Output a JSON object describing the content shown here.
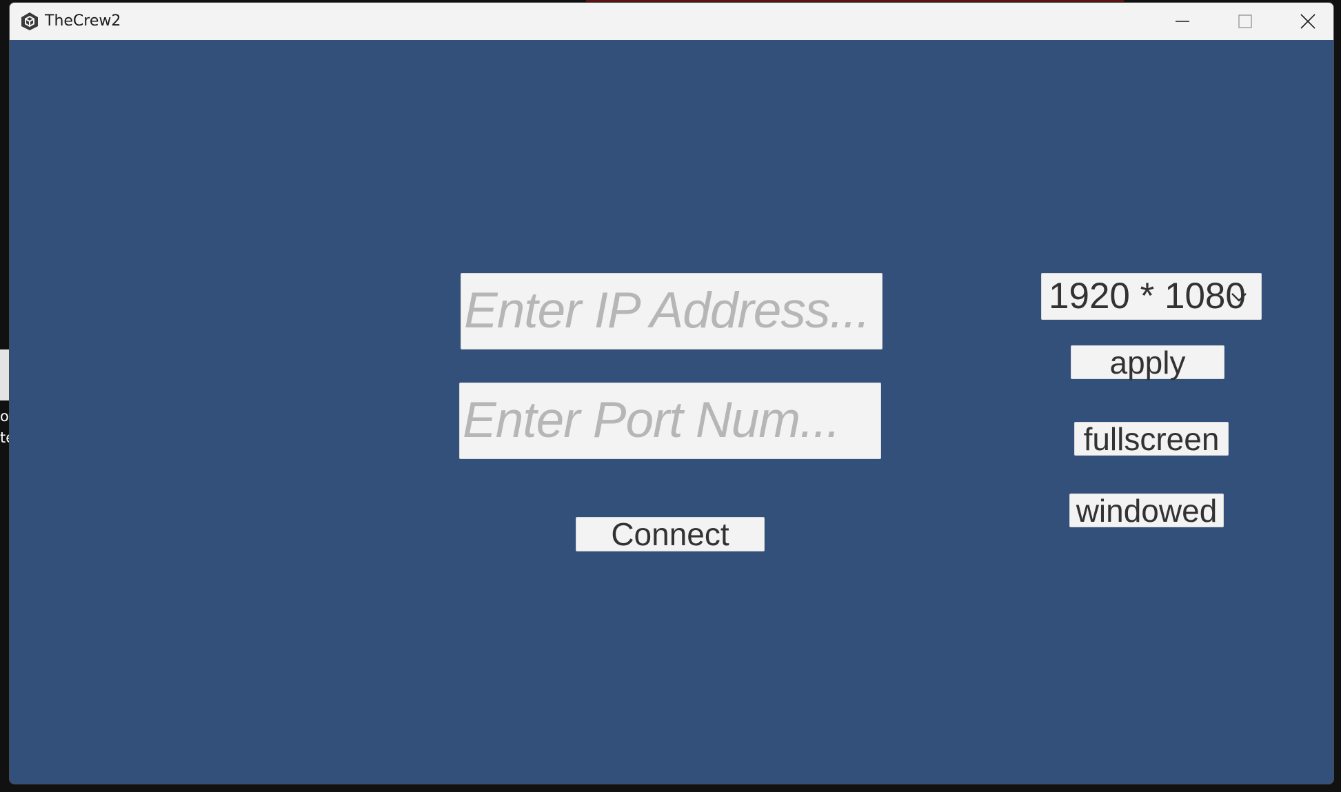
{
  "window": {
    "title": "TheCrew2",
    "app_icon": "unity-cube-icon",
    "controls": [
      "minimize-icon",
      "maximize-icon",
      "close-icon"
    ]
  },
  "connection": {
    "ip_placeholder": "Enter IP Address...",
    "port_placeholder": "Enter Port Num...",
    "connect_label": "Connect"
  },
  "display": {
    "resolution_selected": "1920 * 1080",
    "apply_label": "apply",
    "fullscreen_label": "fullscreen",
    "windowed_label": "windowed"
  },
  "background_desktop": {
    "line1": "o",
    "line2": "te"
  },
  "colors": {
    "client_background": "#33507b",
    "titlebar": "#f3f3f3",
    "control_background": "#f3f3f3",
    "placeholder_text": "#b6b6b6",
    "button_text": "#323232"
  }
}
